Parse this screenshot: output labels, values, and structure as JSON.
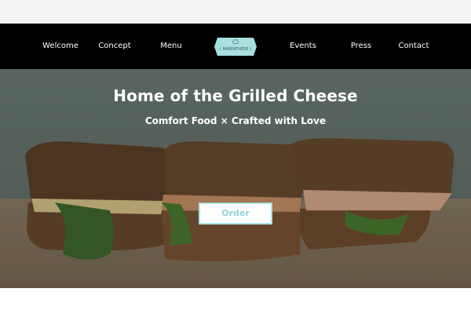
{
  "nav": {
    "items": [
      {
        "label": "Welcome"
      },
      {
        "label": "Concept"
      },
      {
        "label": "Menu"
      },
      {
        "label": "Events"
      },
      {
        "label": "Press"
      },
      {
        "label": "Contact"
      }
    ],
    "logo_text": "( PARENTHÈSE )",
    "logo_icon": "chef-hat-icon"
  },
  "hero": {
    "title": "Home of the Grilled Cheese",
    "subtitle": "Comfort Food × Crafted with Love",
    "order_label": "Order",
    "image": "grilled-cheese-sandwiches-photo"
  },
  "colors": {
    "navbar": "#000000",
    "logo_fill": "#a8dfe0",
    "accent": "#8fd6d9"
  }
}
